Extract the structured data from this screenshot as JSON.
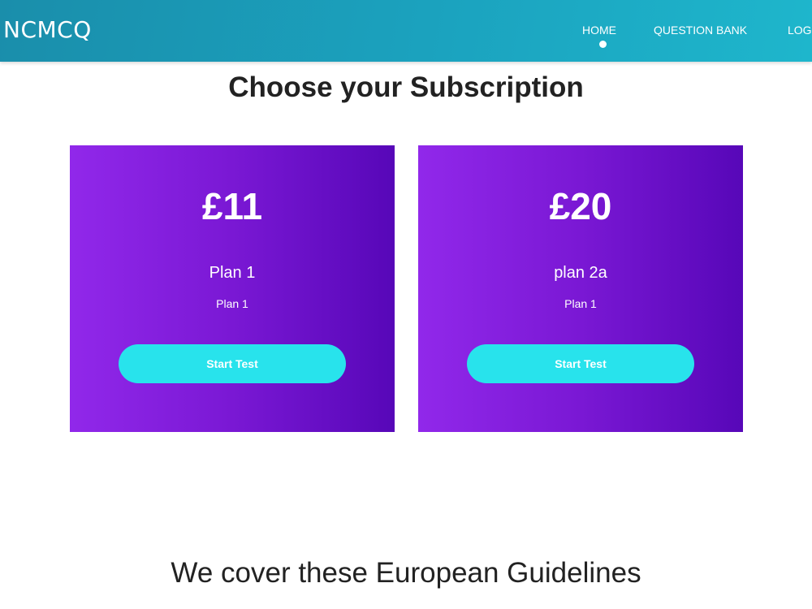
{
  "navbar": {
    "logo": "NCMCQ",
    "items": [
      {
        "label": "HOME",
        "active": true
      },
      {
        "label": "QUESTION BANK",
        "active": false
      },
      {
        "label": "LOG",
        "active": false
      }
    ]
  },
  "main": {
    "title": "Choose your Subscription",
    "plans": [
      {
        "price": "£11",
        "name": "Plan 1",
        "description": "Plan 1",
        "button_label": "Start Test"
      },
      {
        "price": "£20",
        "name": "plan 2a",
        "description": "Plan 1",
        "button_label": "Start Test"
      }
    ]
  },
  "guidelines": {
    "title": "We cover these European Guidelines"
  },
  "colors": {
    "navbar": "#1ba3bf",
    "card_start": "#9128ea",
    "card_end": "#5707b8",
    "button": "#28e3ec"
  }
}
